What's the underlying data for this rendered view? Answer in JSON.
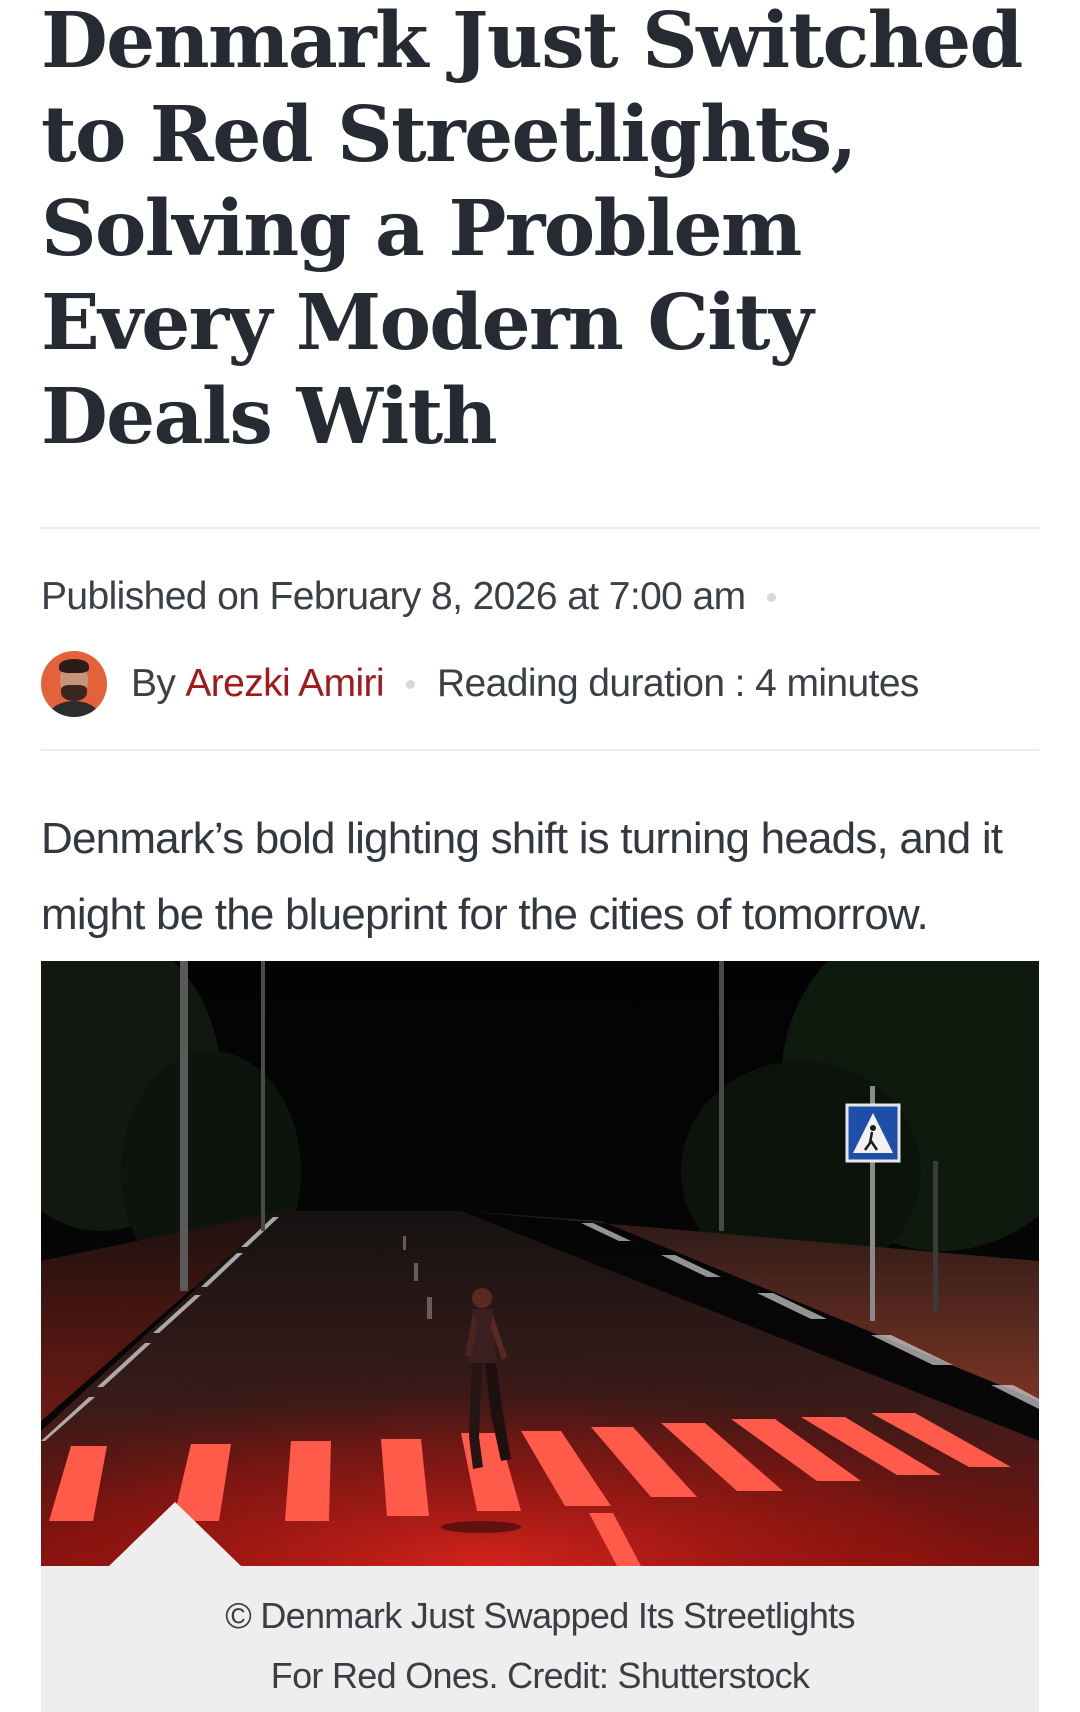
{
  "article": {
    "headline": "Denmark Just Switched to Red Streetlights, Solving a Problem Every Modern City Deals With",
    "published": "Published on February 8, 2026 at 7:00 am",
    "by_label": "By",
    "author": "Arezki Amiri",
    "reading_duration": "Reading duration : 4 minutes",
    "lede": "Denmark’s bold lighting shift is turning heads, and it might be the blueprint for the cities of tomorrow."
  },
  "figure": {
    "caption_line1": "© Denmark Just Swapped Its Streetlights",
    "caption_line2": "For Red Ones. Credit: Shutterstock",
    "sign_icon": "pedestrian-crossing-icon"
  },
  "colors": {
    "author_link": "#a31818",
    "headline": "#262b33",
    "caption_bg": "#eeeeee",
    "red_light": "#e0261f"
  }
}
